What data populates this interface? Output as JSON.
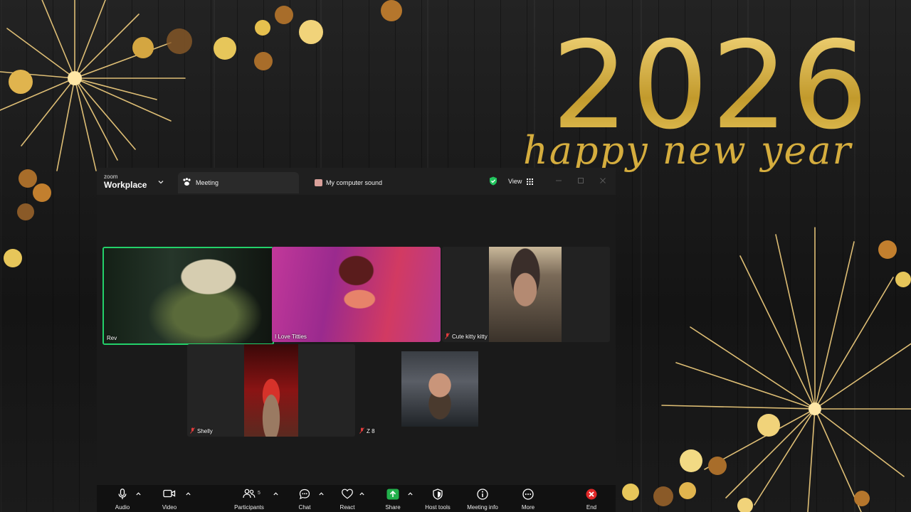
{
  "wallpaper": {
    "year": "2026",
    "greeting": "happy new year",
    "colors": {
      "gold": "#d8b240",
      "wood": "#1b1b1b"
    }
  },
  "window": {
    "brand_small": "zoom",
    "brand_big": "Workplace",
    "tabs": [
      {
        "label": "Meeting",
        "icon": "paw-icon"
      },
      {
        "label": "My computer sound",
        "icon": "screen-share-icon"
      }
    ],
    "view_label": "View",
    "security_color": "#22c55e"
  },
  "participants": [
    {
      "name": "Rev",
      "muted": false,
      "active_speaker": true,
      "bg": "#1d2a20"
    },
    {
      "name": "I Love Titties",
      "muted": false,
      "active_speaker": false,
      "bg": "#7a2460"
    },
    {
      "name": "Cute kitty kitty",
      "muted": true,
      "active_speaker": false,
      "bg": "#6b5140"
    },
    {
      "name": "Shelly",
      "muted": true,
      "active_speaker": false,
      "bg": "#5a1010"
    },
    {
      "name": "Z 8",
      "muted": true,
      "active_speaker": false,
      "bg": "#2c2c2c"
    }
  ],
  "toolbar": {
    "items": [
      {
        "label": "Audio",
        "icon": "microphone-icon"
      },
      {
        "label": "Video",
        "icon": "video-camera-icon"
      },
      {
        "label": "Participants",
        "icon": "participants-icon",
        "count": "5"
      },
      {
        "label": "Chat",
        "icon": "chat-icon"
      },
      {
        "label": "React",
        "icon": "heart-icon"
      },
      {
        "label": "Share",
        "icon": "share-arrow-icon"
      },
      {
        "label": "Host tools",
        "icon": "shield-icon"
      },
      {
        "label": "Meeting info",
        "icon": "info-icon"
      },
      {
        "label": "More",
        "icon": "more-icon"
      },
      {
        "label": "End",
        "icon": "end-icon"
      }
    ],
    "colors": {
      "share": "#22b14c",
      "end": "#e02828"
    }
  }
}
